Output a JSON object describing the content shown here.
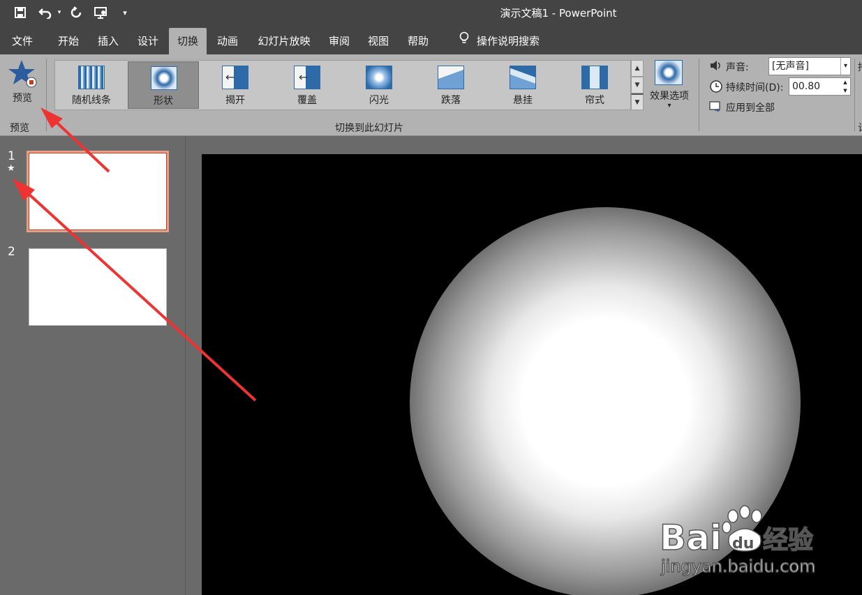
{
  "window": {
    "title": "演示文稿1 - PowerPoint"
  },
  "quick_access": {
    "save_icon": "save-icon",
    "undo_icon": "undo-icon",
    "redo_icon": "redo-icon",
    "present_icon": "present-from-start-icon",
    "customize_glyph": "▾"
  },
  "tabs": [
    {
      "label": "文件"
    },
    {
      "label": "开始"
    },
    {
      "label": "插入"
    },
    {
      "label": "设计"
    },
    {
      "label": "切换"
    },
    {
      "label": "动画"
    },
    {
      "label": "幻灯片放映"
    },
    {
      "label": "审阅"
    },
    {
      "label": "视图"
    },
    {
      "label": "帮助"
    }
  ],
  "active_tab": "切换",
  "tell_me": {
    "label": "操作说明搜索",
    "icon": "lightbulb-icon"
  },
  "ribbon": {
    "preview": {
      "label": "预览",
      "group_label": "预览"
    },
    "transitions": {
      "group_label": "切换到此幻灯片",
      "items": [
        {
          "label": "随机线条"
        },
        {
          "label": "形状"
        },
        {
          "label": "揭开"
        },
        {
          "label": "覆盖"
        },
        {
          "label": "闪光"
        },
        {
          "label": "跌落"
        },
        {
          "label": "悬挂"
        },
        {
          "label": "帘式"
        }
      ],
      "selected": "形状",
      "scroll_up": "▲",
      "scroll_down": "▼",
      "more": "▼"
    },
    "effect_options": {
      "label": "效果选项",
      "arrow": "▾"
    },
    "timing": {
      "sound_label": "声音:",
      "sound_value": "[无声音]",
      "duration_label": "持续时间(D):",
      "duration_value": "00.80",
      "apply_all_label": "应用到全部",
      "spin_up": "▲",
      "spin_down": "▼",
      "dropdown": "▾"
    },
    "truncated_group_chars": [
      "持",
      "计"
    ]
  },
  "slides": [
    {
      "number": "1",
      "transition_marker": "★",
      "selected": true
    },
    {
      "number": "2",
      "selected": false
    }
  ],
  "watermark": {
    "logo": "Bai du 经验",
    "url": "jingyan.baidu.com"
  },
  "colors": {
    "accent": "#c43e1c",
    "selected_thumb_border": "#e5a08a",
    "arrow": "#ee3333"
  }
}
